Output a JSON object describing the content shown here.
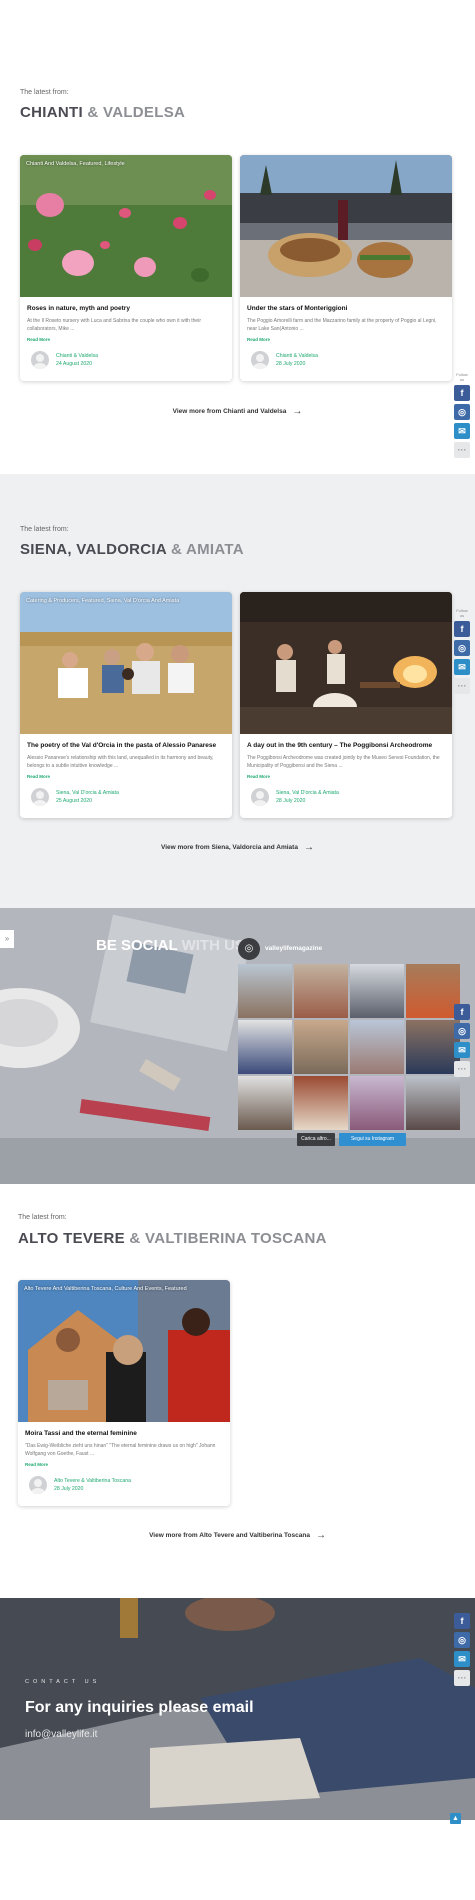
{
  "sections": [
    {
      "latest": "The latest from:",
      "heading_main": "CHIANTI",
      "heading_amp": "& VALDELSA",
      "view_more": "View more from Chianti and Valdelsa",
      "cards": [
        {
          "category": "Chianti And Valdelsa, Featured, Lifestyle",
          "title": "Roses in nature, myth and poetry",
          "excerpt": "At the Il Roseto nursery with Luca and Sabrina the couple who own it with their collaborators, Mike ...",
          "read_more": "Read More",
          "meta_category": "Chianti & Valdelsa",
          "meta_date": "24 August 2020"
        },
        {
          "category": "",
          "title": "Under the stars of Monteriggioni",
          "excerpt": "The Poggio Amorelli farm and the Mazzarino family at the property of Poggio al Legni, near Lake San(Antonio ...",
          "read_more": "Read More",
          "meta_category": "Chianti & Valdelsa",
          "meta_date": "28 July 2020"
        }
      ]
    },
    {
      "latest": "The latest from:",
      "heading_main": "SIENA, VALDORCIA",
      "heading_amp": "& AMIATA",
      "view_more": "View more from Siena, Valdorcia and Amiata",
      "cards": [
        {
          "category": "Catering & Producers, Featured, Siena, Val D'orcia And Amiata",
          "title": "The poetry of the Val d'Orcia in the pasta of Alessio Panarese",
          "excerpt": "Alessio Panarese's relationship with this land, unequalled in its harmony and beauty, belongs to a subtle intuitive knowledge ...",
          "read_more": "Read More",
          "meta_category": "Siena, Val D'orcia & Amiata",
          "meta_date": "25 August 2020"
        },
        {
          "category": "",
          "title": "A day out in the 9th century – The Poggibonsi Archeodrome",
          "excerpt": "The Poggibonsi Archeodrome was created jointly by the Museo Senesi Foundation, the Municipality of Poggibonsi and the Siena ...",
          "read_more": "Read More",
          "meta_category": "Siena, Val D'orcia & Amiata",
          "meta_date": "28 July 2020"
        }
      ]
    },
    {
      "latest": "The latest from:",
      "heading_main": "ALTO TEVERE",
      "heading_amp": "& VALTIBERINA TOSCANA",
      "view_more": "View more from Alto Tevere and Valtiberina Toscana",
      "cards": [
        {
          "category": "Alto Tevere And Valtiberina Toscana, Culture And Events, Featured",
          "title": "Moira Tassi and the eternal feminine",
          "excerpt": "\"Das Ewig-Weibliche zieht uns hinan\" \"The eternal feminine draws us on high\" Johann Wolfgang von Goethe, Faust ...",
          "read_more": "Read More",
          "meta_category": "Alto Tevere & Valtiberina Toscana",
          "meta_date": "28 July 2020"
        }
      ]
    }
  ],
  "share": {
    "label": "Follow us"
  },
  "social": {
    "title_a": "BE SOCIAL",
    "title_b": "WITH US",
    "ig_user": "valleylifemagazine",
    "load_more": "Carica altro...",
    "follow": "Segui su Instagram"
  },
  "contact": {
    "label": "CONTACT US",
    "title": "For any inquiries please email",
    "email": "info@valleylife.it"
  },
  "colors": {
    "accent": "#1ea870",
    "facebook": "#3b5b99",
    "instagram_btn": "#2f8fd1",
    "heading": "#4a4a52"
  }
}
